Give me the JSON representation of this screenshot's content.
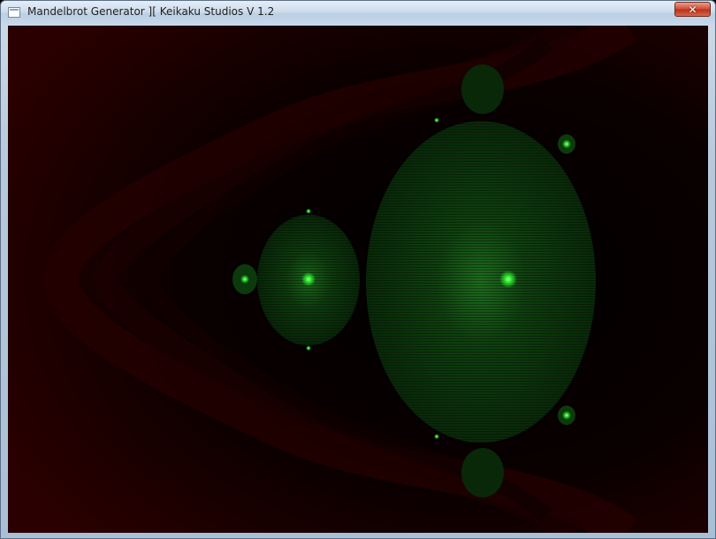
{
  "window": {
    "title": "Mandelbrot Generator ][ Keikaku Studios V 1.2",
    "icon": "application-window-icon",
    "close_symbol": "✕",
    "close_icon": "close-icon"
  },
  "canvas": {
    "content": "mandelbrot-fractal-render",
    "background_color": "#000000",
    "outer_band_color": "#2a0000",
    "set_color": "#0c3a0c",
    "highlight_color": "#22ff22"
  }
}
